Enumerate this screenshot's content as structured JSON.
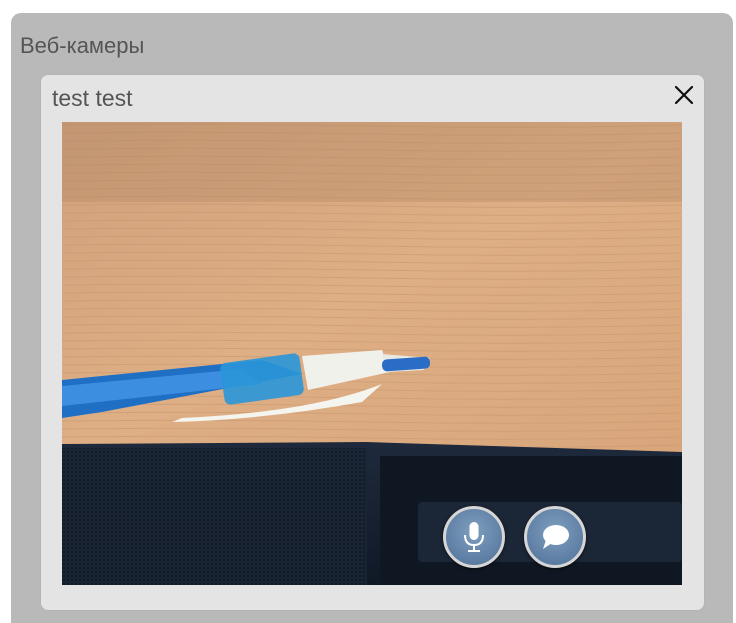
{
  "panel": {
    "title": "Веб-камеры"
  },
  "camera": {
    "user_name": "test test",
    "close_icon": "close-icon",
    "controls": {
      "mic_icon": "microphone-icon",
      "chat_icon": "chat-bubble-icon"
    }
  },
  "colors": {
    "panel_bg": "#b9b9b9",
    "window_bg": "#e4e4e4",
    "text": "#555555",
    "button_blue": "#5d7ea3"
  }
}
